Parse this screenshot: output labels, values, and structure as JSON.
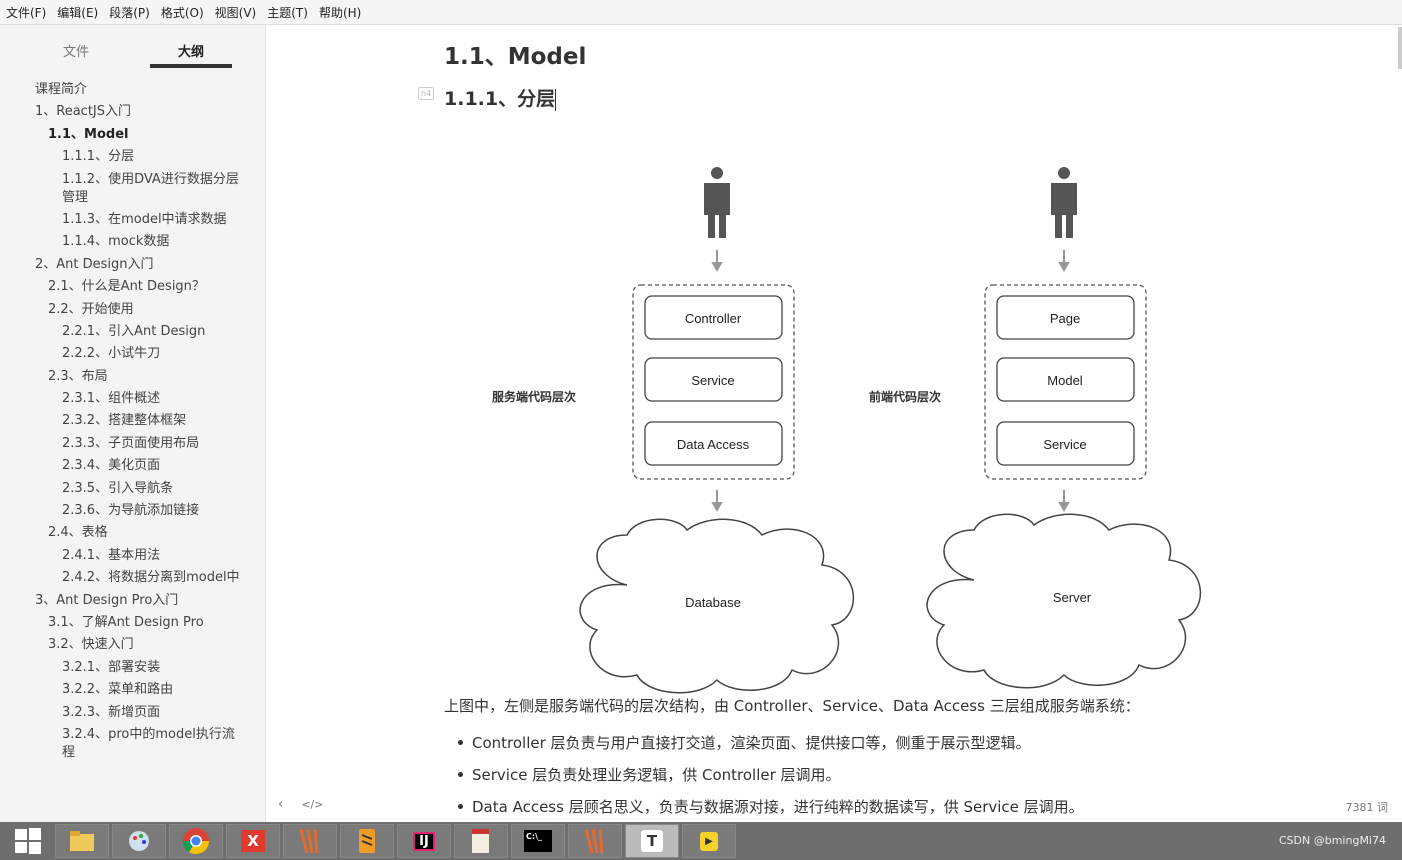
{
  "menu": [
    "文件(F)",
    "编辑(E)",
    "段落(P)",
    "格式(O)",
    "视图(V)",
    "主题(T)",
    "帮助(H)"
  ],
  "sidebar": {
    "tabs": [
      "文件",
      "大纲"
    ],
    "active_tab": "大纲",
    "outline": [
      {
        "label": "课程简介",
        "level": 0
      },
      {
        "label": "1、ReactJS入门",
        "level": 0
      },
      {
        "label": "1.1、Model",
        "level": 1,
        "active": true
      },
      {
        "label": "1.1.1、分层",
        "level": 2
      },
      {
        "label": "1.1.2、使用DVA进行数据分层管理",
        "level": 2
      },
      {
        "label": "1.1.3、在model中请求数据",
        "level": 2
      },
      {
        "label": "1.1.4、mock数据",
        "level": 2
      },
      {
        "label": "2、Ant Design入门",
        "level": 0
      },
      {
        "label": "2.1、什么是Ant Design？",
        "level": 1
      },
      {
        "label": "2.2、开始使用",
        "level": 1
      },
      {
        "label": "2.2.1、引入Ant Design",
        "level": 2
      },
      {
        "label": "2.2.2、小试牛刀",
        "level": 2
      },
      {
        "label": "2.3、布局",
        "level": 1
      },
      {
        "label": "2.3.1、组件概述",
        "level": 2
      },
      {
        "label": "2.3.2、搭建整体框架",
        "level": 2
      },
      {
        "label": "2.3.3、子页面使用布局",
        "level": 2
      },
      {
        "label": "2.3.4、美化页面",
        "level": 2
      },
      {
        "label": "2.3.5、引入导航条",
        "level": 2
      },
      {
        "label": "2.3.6、为导航添加链接",
        "level": 2
      },
      {
        "label": "2.4、表格",
        "level": 1
      },
      {
        "label": "2.4.1、基本用法",
        "level": 2
      },
      {
        "label": "2.4.2、将数据分离到model中",
        "level": 2
      },
      {
        "label": "3、Ant Design Pro入门",
        "level": 0
      },
      {
        "label": "3.1、了解Ant Design Pro",
        "level": 1
      },
      {
        "label": "3.2、快速入门",
        "level": 1
      },
      {
        "label": "3.2.1、部署安装",
        "level": 2
      },
      {
        "label": "3.2.2、菜单和路由",
        "level": 2
      },
      {
        "label": "3.2.3、新增页面",
        "level": 2
      },
      {
        "label": "3.2.4、pro中的model执行流程",
        "level": 2
      }
    ]
  },
  "doc": {
    "h2": "1.1、Model",
    "h3": "1.1.1、分层",
    "h4_badge": "h4",
    "diagram": {
      "left": {
        "label": "服务端代码层次",
        "layers": [
          "Controller",
          "Service",
          "Data Access"
        ],
        "cloud": "Database"
      },
      "right": {
        "label": "前端代码层次",
        "layers": [
          "Page",
          "Model",
          "Service"
        ],
        "cloud": "Server"
      }
    },
    "paragraph": "上图中，左侧是服务端代码的层次结构，由 Controller、Service、Data Access 三层组成服务端系统：",
    "bullets": [
      "Controller 层负责与用户直接打交道，渲染页面、提供接口等，侧重于展示型逻辑。",
      "Service 层负责处理业务逻辑，供 Controller 层调用。",
      "Data Access 层顾名思义，负责与数据源对接，进行纯粹的数据读写，供 Service 层调用。"
    ]
  },
  "footer": {
    "nav_prev": "‹",
    "nav_source": "</>",
    "word_count": "7381 词"
  },
  "taskbar": {
    "apps": [
      "file-explorer",
      "paint",
      "chrome",
      "xmind",
      "app-stripes",
      "sublime",
      "intellij",
      "notepad",
      "cmd",
      "app-stripes-2",
      "typora",
      "player"
    ],
    "tray_text": "CSDN @bmingMi74"
  }
}
